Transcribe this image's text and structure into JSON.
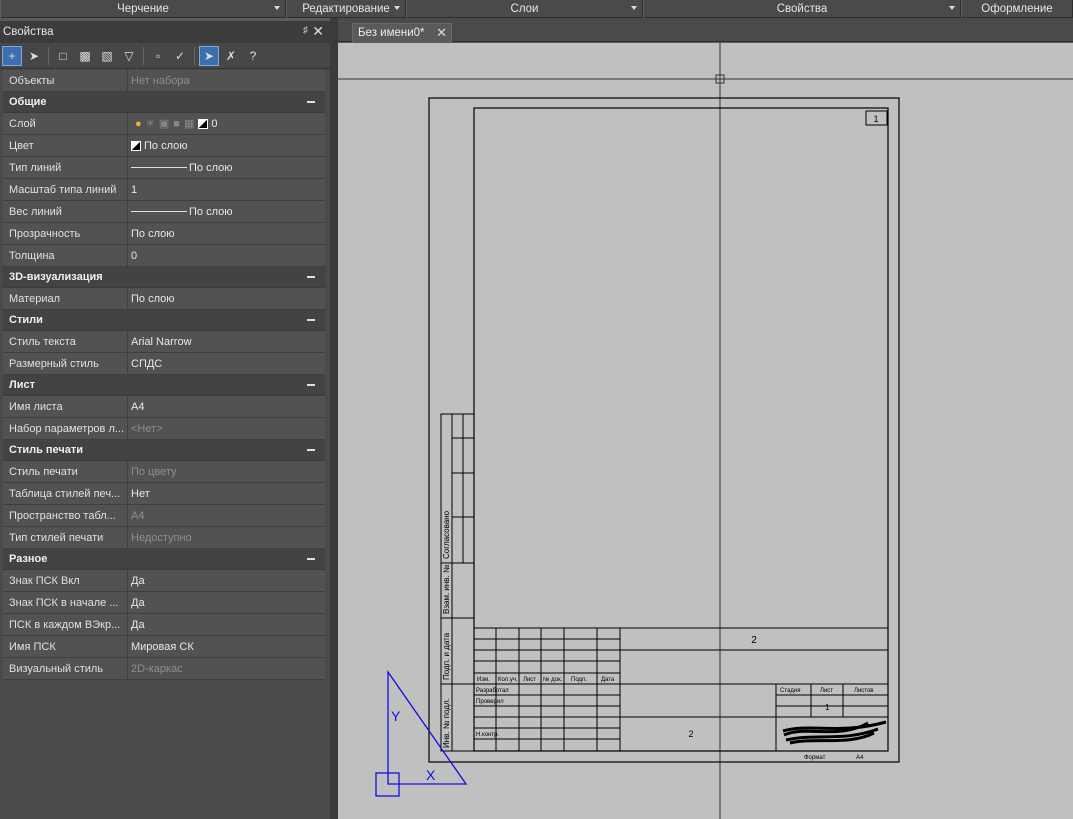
{
  "menu": [
    {
      "label": "Черчение"
    },
    {
      "label": "Редактирование"
    },
    {
      "label": "Слои"
    },
    {
      "label": "Свойства"
    },
    {
      "label": "Оформление"
    }
  ],
  "panel": {
    "title": "Свойства"
  },
  "objects": {
    "label": "Объекты",
    "value": "Нет набора"
  },
  "groups": [
    {
      "title": "Общие",
      "rows": [
        {
          "label": "Слой",
          "value": "0"
        },
        {
          "label": "Цвет",
          "value": "По слою"
        },
        {
          "label": "Тип линий",
          "value": "По слою"
        },
        {
          "label": "Масштаб типа линий",
          "value": "1"
        },
        {
          "label": "Вес линий",
          "value": "По слою"
        },
        {
          "label": "Прозрачность",
          "value": "По слою"
        },
        {
          "label": "Толщина",
          "value": "0"
        }
      ]
    },
    {
      "title": "3D-визуализация",
      "rows": [
        {
          "label": "Материал",
          "value": "По слою"
        }
      ]
    },
    {
      "title": "Стили",
      "rows": [
        {
          "label": "Стиль текста",
          "value": "Arial Narrow"
        },
        {
          "label": "Размерный стиль",
          "value": "СПДС"
        }
      ]
    },
    {
      "title": "Лист",
      "rows": [
        {
          "label": "Имя листа",
          "value": "A4"
        },
        {
          "label": "Набор параметров л...",
          "value": "<Нет>",
          "dim": true
        }
      ]
    },
    {
      "title": "Стиль печати",
      "rows": [
        {
          "label": "Стиль печати",
          "value": "По цвету",
          "dim": true
        },
        {
          "label": "Таблица стилей печ...",
          "value": "Нет"
        },
        {
          "label": "Пространство табл...",
          "value": "A4",
          "dim": true
        },
        {
          "label": "Тип стилей печати",
          "value": "Недоступно",
          "dim": true
        }
      ]
    },
    {
      "title": "Разное",
      "rows": [
        {
          "label": "Знак ПСК Вкл",
          "value": "Да"
        },
        {
          "label": "Знак ПСК в начале ...",
          "value": "Да"
        },
        {
          "label": "ПСК в каждом ВЭкр...",
          "value": "Да"
        },
        {
          "label": "Имя ПСК",
          "value": "Мировая СК"
        },
        {
          "label": "Визуальный стиль",
          "value": "2D-каркас",
          "dim": true
        }
      ]
    }
  ],
  "tab": {
    "label": "Без имени0*"
  },
  "sheet": {
    "sheet_num": "1",
    "sheet_num2": "2",
    "sheet_num3": "2",
    "side_labels": [
      "Согласовано",
      "Взам. инв. №",
      "Подп. и дата",
      "Инв. № подл."
    ],
    "cols": [
      "Изм.",
      "Кол.уч.",
      "Лист",
      "№ док.",
      "Подп.",
      "Дата"
    ],
    "stage_cols": [
      "Стадия",
      "Лист",
      "Листов"
    ],
    "rows": [
      "Разработал",
      "Проверил",
      "Н.контр."
    ],
    "sheet_value": "1",
    "format_label": "Формат",
    "format_value": "A4"
  },
  "ucs": {
    "x": "X",
    "y": "Y"
  },
  "colors": {
    "ucs": "#1010e0",
    "bg": "#c0c0c0"
  }
}
